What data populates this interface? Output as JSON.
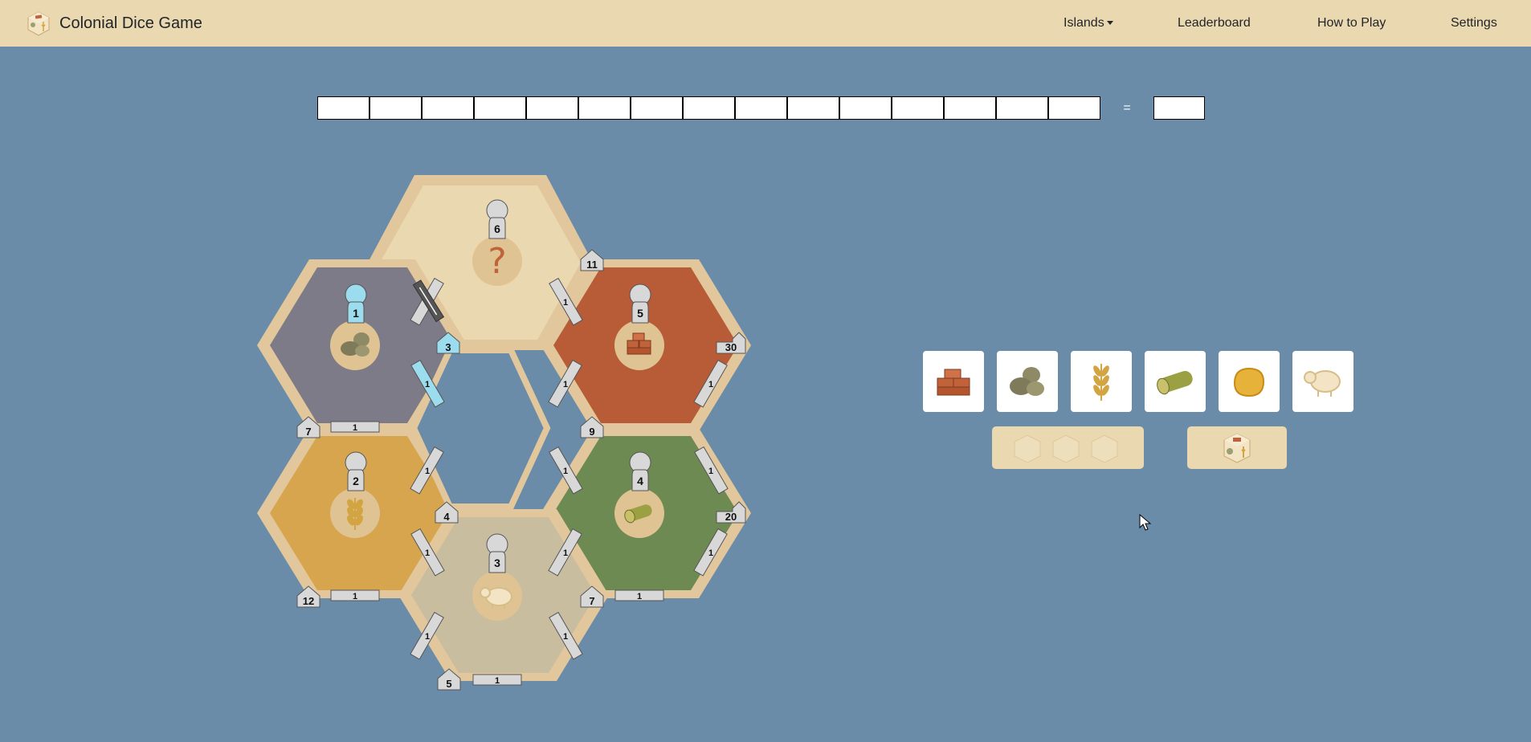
{
  "app": {
    "title": "Colonial Dice Game",
    "logo_icon": "dice-logo-icon"
  },
  "nav": {
    "islands": "Islands",
    "leaderboard": "Leaderboard",
    "how_to_play": "How to Play",
    "settings": "Settings"
  },
  "score": {
    "cell_count": 15,
    "equals": "=",
    "total": ""
  },
  "colors": {
    "background": "#6a8ca8",
    "navbar": "#ead8b1",
    "hex_border": "#e2c79c",
    "ore": "#7c7b87",
    "brick": "#b85c37",
    "grain": "#d8a54f",
    "lumber": "#6d8a53",
    "wool": "#c9bda0",
    "desert": "#ead8b1",
    "built": "#9cdcef"
  },
  "hexes": [
    {
      "id": "top",
      "resource": "desert",
      "knight": "6",
      "icon": "question-icon",
      "built": false
    },
    {
      "id": "upper-left",
      "resource": "ore",
      "knight": "1",
      "icon": "ore-icon",
      "built": true
    },
    {
      "id": "upper-right",
      "resource": "brick",
      "knight": "5",
      "icon": "brick-icon",
      "built": false
    },
    {
      "id": "lower-left",
      "resource": "grain",
      "knight": "2",
      "icon": "grain-icon",
      "built": false
    },
    {
      "id": "lower-right",
      "resource": "lumber",
      "knight": "4",
      "icon": "lumber-icon",
      "built": false
    },
    {
      "id": "bottom",
      "resource": "wool",
      "knight": "3",
      "icon": "wool-icon",
      "built": false
    }
  ],
  "settlements": [
    {
      "label": "3",
      "built": true
    },
    {
      "label": "4",
      "built": false
    },
    {
      "label": "5",
      "built": false
    },
    {
      "label": "7",
      "built": false
    },
    {
      "label": "9",
      "built": false
    },
    {
      "label": "11",
      "built": false
    },
    {
      "label": "7",
      "built": false
    },
    {
      "label": "12",
      "built": false
    }
  ],
  "cities": [
    {
      "label": "30",
      "built": false
    },
    {
      "label": "20",
      "built": false
    }
  ],
  "road_label": "1",
  "resources": [
    {
      "name": "brick",
      "icon": "brick-icon"
    },
    {
      "name": "ore",
      "icon": "ore-icon"
    },
    {
      "name": "grain",
      "icon": "grain-icon"
    },
    {
      "name": "lumber",
      "icon": "lumber-icon"
    },
    {
      "name": "gold",
      "icon": "gold-icon"
    },
    {
      "name": "wool",
      "icon": "wool-icon"
    }
  ],
  "dice": {
    "rolls_remaining_icon": "dice-icon",
    "roll_button_icon": "dice-icon"
  }
}
